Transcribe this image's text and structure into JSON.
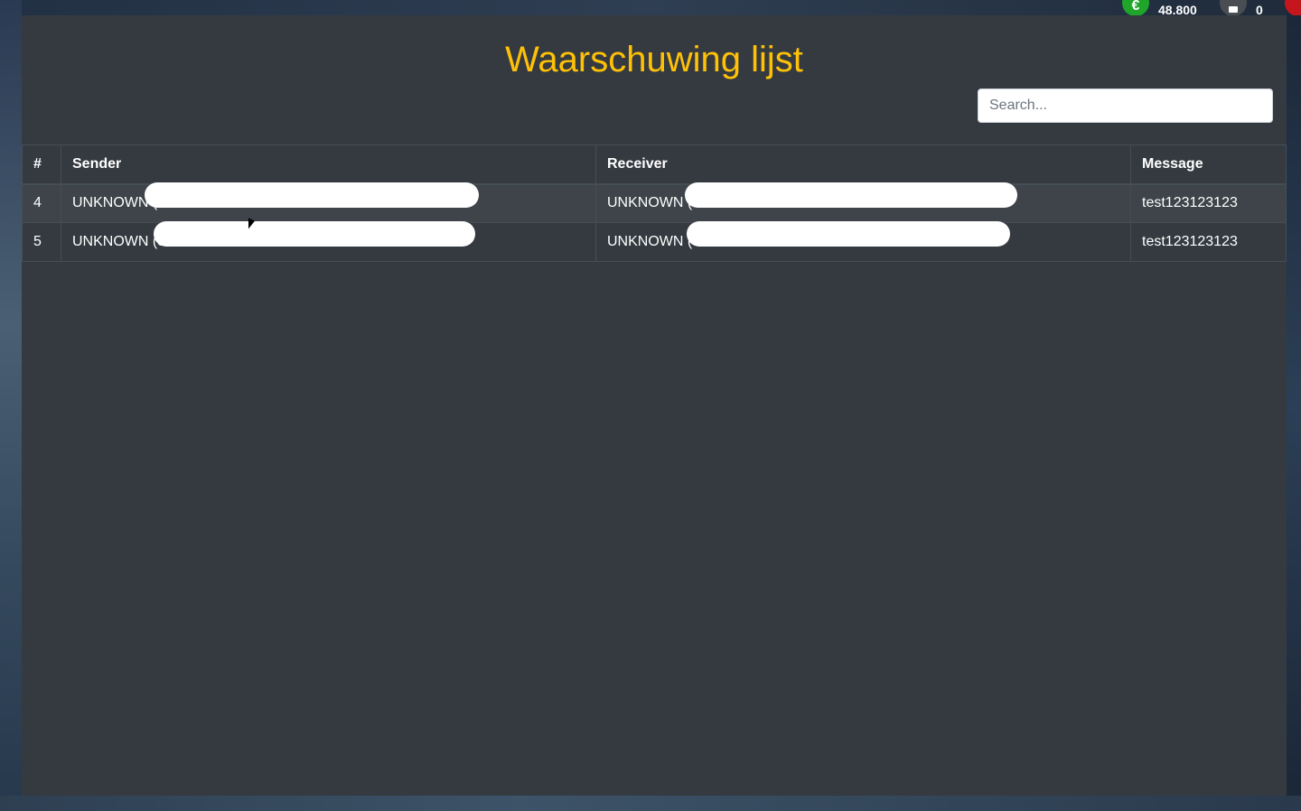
{
  "hud": {
    "money_icon": "euro-icon",
    "money_glyph": "€",
    "money_value": "48.800",
    "bank_icon": "wallet-icon",
    "bank_value": "0",
    "extra_icon": "notification-icon"
  },
  "panel": {
    "title": "Waarschuwing lijst",
    "search_placeholder": "Search..."
  },
  "table": {
    "headers": {
      "id": "#",
      "sender": "Sender",
      "receiver": "Receiver",
      "message": "Message"
    },
    "rows": [
      {
        "id": "4",
        "sender": "UNKNOWN (",
        "receiver": "UNKNOWN (",
        "message": "test123123123"
      },
      {
        "id": "5",
        "sender": "UNKNOWN (3",
        "receiver": "UNKNOWN (",
        "message": "test123123123"
      }
    ]
  },
  "colors": {
    "title": "#ffc107",
    "panel_bg": "#343a40",
    "border": "#454d55",
    "money_icon": "#1fa62a"
  }
}
